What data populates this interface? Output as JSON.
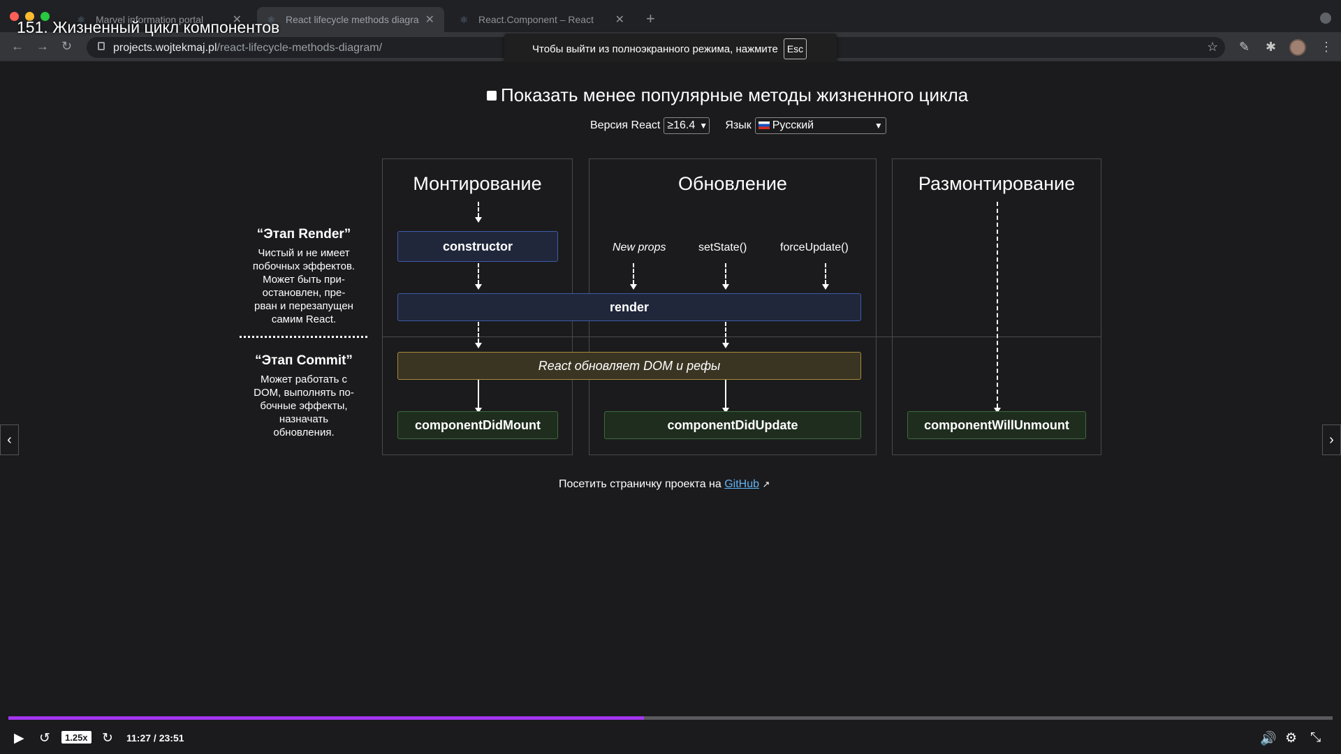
{
  "browser": {
    "tabs": [
      {
        "label": "Marvel information portal"
      },
      {
        "label": "React lifecycle methods diagra"
      },
      {
        "label": "React.Component – React"
      }
    ],
    "new_tab": "+",
    "url_host": "projects.wojtekmaj.pl",
    "url_path": "/react-lifecycle-methods-diagram/"
  },
  "course_title": "151. Жизненный цикл компонентов",
  "fullscreen_banner": {
    "text": "Чтобы выйти из полноэкранного режима, нажмите",
    "key": "Esc"
  },
  "diagram": {
    "show_less_label": "Показать менее популярные методы жизненного цикла",
    "version_label": "Версия React",
    "version_value": "≥16.4",
    "language_label": "Язык",
    "language_value": "Русский",
    "columns": {
      "mounting": "Монтирование",
      "updating": "Обновление",
      "unmounting": "Размонтирование"
    },
    "triggers": {
      "new_props": "New props",
      "set_state": "setState()",
      "force_update": "forceUpdate()"
    },
    "boxes": {
      "constructor": "constructor",
      "render": "render",
      "dom_update": "React обновляет DOM и рефы",
      "did_mount": "componentDidMount",
      "did_update": "componentDidUpdate",
      "will_unmount": "componentWillUnmount"
    },
    "phases": {
      "render_title": "“Этап Render”",
      "render_desc": [
        "Чистый и не имеет",
        "побочных эффектов.",
        "Может быть при-",
        "остановлен, пре-",
        "рван и перезапущен",
        "самим React."
      ],
      "commit_title": "“Этап Commit”",
      "commit_desc": [
        "Может работать с",
        "DOM, выполнять по-",
        "бочные эффекты,",
        "назначать",
        "обновления."
      ]
    },
    "footer_text": "Посетить страничку проекта на",
    "footer_link": "GitHub"
  },
  "player": {
    "speed": "1.25x",
    "time": "11:27 / 23:51",
    "progress": 0.48
  },
  "colors": {
    "accent": "#a435f0",
    "blue_box": "#3d5ba8",
    "yellow_box": "#a88a3d",
    "green_box": "#3d6b3d"
  }
}
